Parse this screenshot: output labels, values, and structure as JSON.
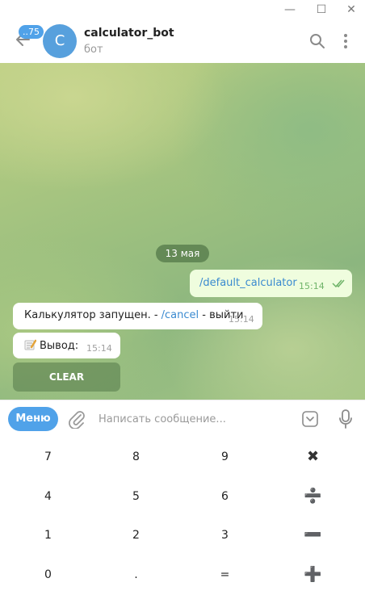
{
  "window": {
    "minimize": "—",
    "maximize": "☐",
    "close": "✕"
  },
  "header": {
    "unread_count": "..75",
    "avatar_letter": "C",
    "title": "calculator_bot",
    "subtitle": "бот"
  },
  "chat": {
    "date": "13 мая",
    "outgoing": {
      "text": "/default_calculator",
      "time": "15:14"
    },
    "incoming": [
      {
        "text_before": "Калькулятор запущен. - ",
        "link": "/cancel",
        "text_after": " - выйти",
        "time": "15:14"
      },
      {
        "text": "Вывод:",
        "time": "15:14"
      }
    ],
    "inline_button": "CLEAR"
  },
  "input": {
    "menu_label": "Меню",
    "placeholder": "Написать сообщение..."
  },
  "keyboard": {
    "rows": [
      [
        "7",
        "8",
        "9",
        "✖"
      ],
      [
        "4",
        "5",
        "6",
        "➗"
      ],
      [
        "1",
        "2",
        "3",
        "➖"
      ],
      [
        "0",
        ".",
        "=",
        "➕"
      ]
    ]
  },
  "colors": {
    "accent": "#50a2e9",
    "outgoing_bubble": "#effdde"
  }
}
